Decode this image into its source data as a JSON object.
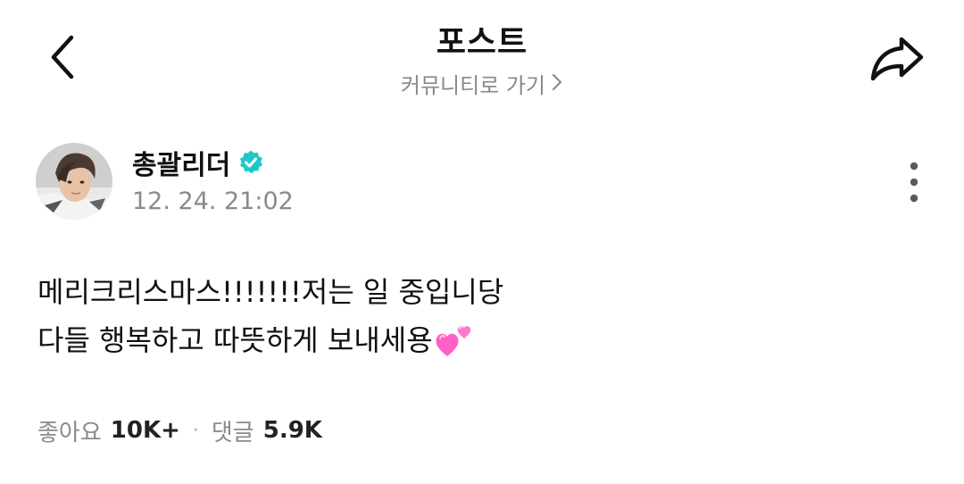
{
  "header": {
    "title": "포스트",
    "community_link": "커뮤니티로 가기",
    "back_icon": "chevron-left-icon",
    "share_icon": "share-icon"
  },
  "post": {
    "author": {
      "name": "총괄리더",
      "verified": true,
      "verified_color": "#1ec8c8",
      "avatar": "avatar-photo"
    },
    "timestamp": "12. 24. 21:02",
    "more_icon": "more-vertical-icon",
    "body": {
      "line1": "메리크리스마스!!!!!!!저는 일 중입니당",
      "line2": "다들 행복하고 따뜻하게 보내세용",
      "emoji": "two-hearts-icon"
    },
    "stats": {
      "likes_label": "좋아요",
      "likes_value": "10K+",
      "separator": "·",
      "comments_label": "댓글",
      "comments_value": "5.9K"
    }
  },
  "colors": {
    "text_primary": "#111111",
    "text_secondary": "#8a8a8a",
    "background": "#ffffff",
    "heart_pink": "#ff5fc8"
  }
}
